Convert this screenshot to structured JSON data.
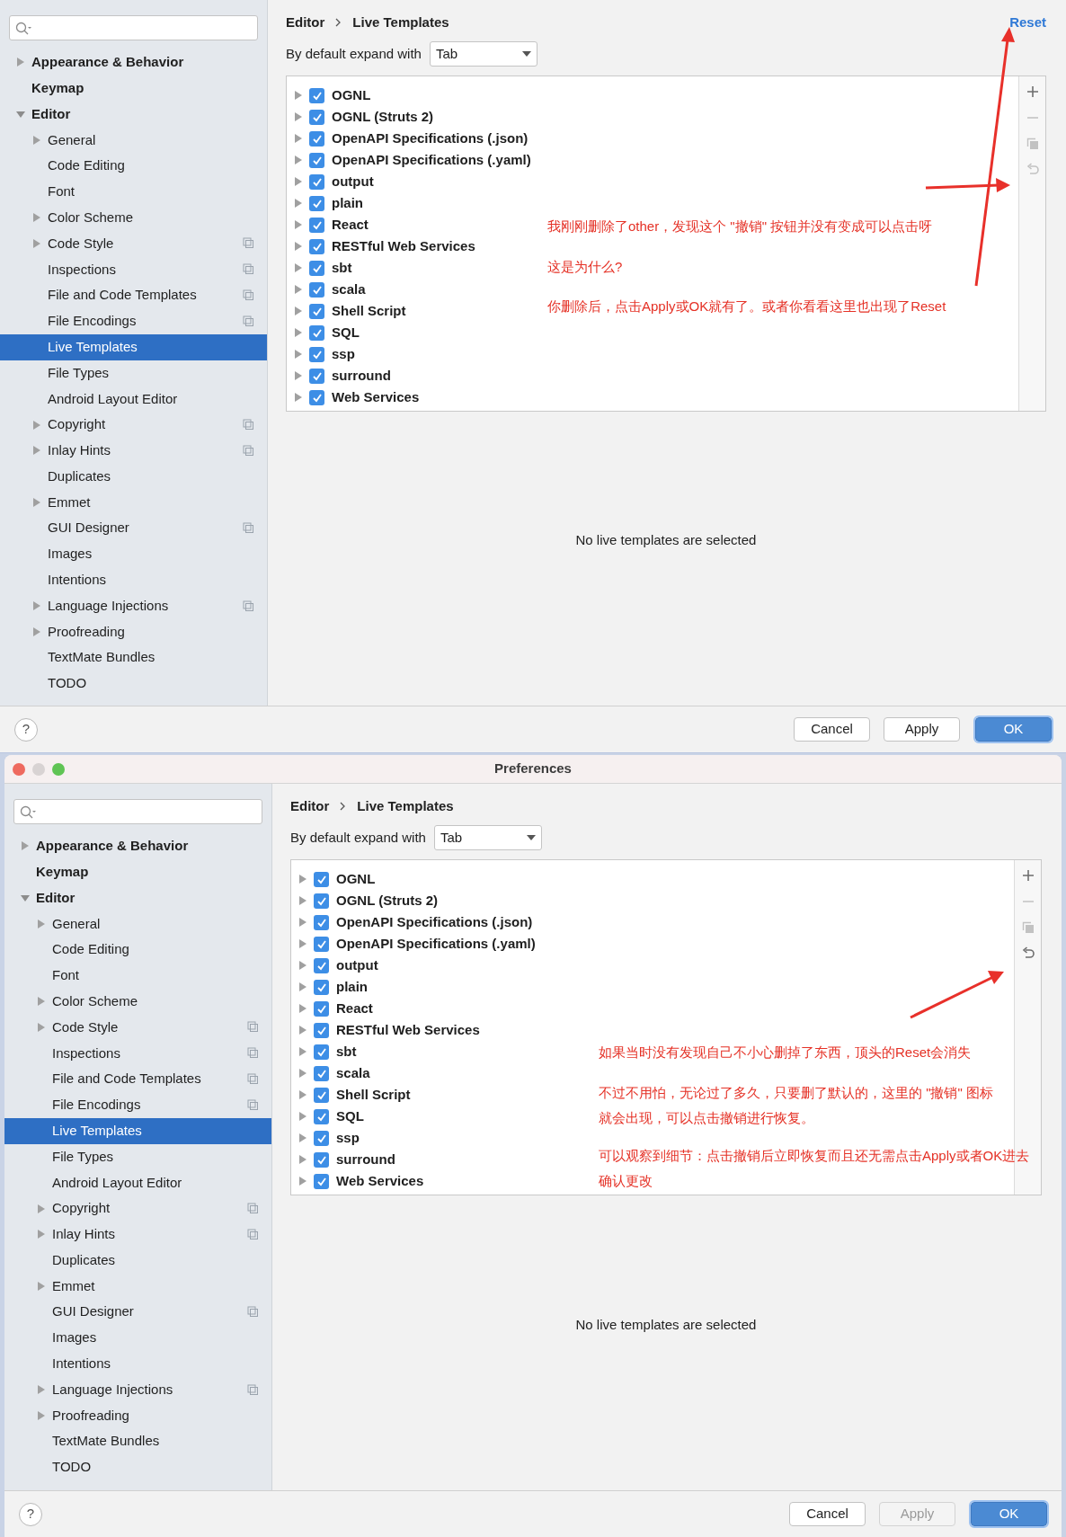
{
  "dialogs": [
    {
      "breadcrumb": [
        "Editor",
        "Live Templates"
      ],
      "reset_link": "Reset",
      "expand_label": "By default expand with",
      "expand_value": "Tab",
      "sidebar": [
        {
          "label": "Appearance & Behavior",
          "bold": true,
          "expanded": false,
          "scoped": false,
          "selected": false
        },
        {
          "label": "Keymap",
          "bold": true,
          "scoped": false,
          "selected": false
        },
        {
          "label": "Editor",
          "bold": true,
          "expanded": true,
          "scoped": false,
          "selected": false,
          "children": [
            {
              "label": "General",
              "expanded": false,
              "scoped": false,
              "selected": false
            },
            {
              "label": "Code Editing",
              "scoped": false,
              "selected": false
            },
            {
              "label": "Font",
              "scoped": false,
              "selected": false
            },
            {
              "label": "Color Scheme",
              "expanded": false,
              "scoped": false,
              "selected": false
            },
            {
              "label": "Code Style",
              "expanded": false,
              "scoped": true,
              "selected": false
            },
            {
              "label": "Inspections",
              "scoped": true,
              "selected": false
            },
            {
              "label": "File and Code Templates",
              "scoped": true,
              "selected": false
            },
            {
              "label": "File Encodings",
              "scoped": true,
              "selected": false
            },
            {
              "label": "Live Templates",
              "scoped": false,
              "selected": true
            },
            {
              "label": "File Types",
              "scoped": false,
              "selected": false
            },
            {
              "label": "Android Layout Editor",
              "scoped": false,
              "selected": false
            },
            {
              "label": "Copyright",
              "expanded": false,
              "scoped": true,
              "selected": false
            },
            {
              "label": "Inlay Hints",
              "expanded": false,
              "scoped": true,
              "selected": false
            },
            {
              "label": "Duplicates",
              "scoped": false,
              "selected": false
            },
            {
              "label": "Emmet",
              "expanded": false,
              "scoped": false,
              "selected": false
            },
            {
              "label": "GUI Designer",
              "scoped": true,
              "selected": false
            },
            {
              "label": "Images",
              "scoped": false,
              "selected": false
            },
            {
              "label": "Intentions",
              "scoped": false,
              "selected": false
            },
            {
              "label": "Language Injections",
              "expanded": false,
              "scoped": true,
              "selected": false
            },
            {
              "label": "Proofreading",
              "expanded": false,
              "scoped": false,
              "selected": false
            },
            {
              "label": "TextMate Bundles",
              "scoped": false,
              "selected": false
            },
            {
              "label": "TODO",
              "scoped": false,
              "selected": false
            }
          ]
        }
      ],
      "templates": [
        {
          "name": "OGNL",
          "checked": true
        },
        {
          "name": "OGNL (Struts 2)",
          "checked": true
        },
        {
          "name": "OpenAPI Specifications (.json)",
          "checked": true
        },
        {
          "name": "OpenAPI Specifications (.yaml)",
          "checked": true
        },
        {
          "name": "output",
          "checked": true
        },
        {
          "name": "plain",
          "checked": true
        },
        {
          "name": "React",
          "checked": true
        },
        {
          "name": "RESTful Web Services",
          "checked": true
        },
        {
          "name": "sbt",
          "checked": true
        },
        {
          "name": "scala",
          "checked": true
        },
        {
          "name": "Shell Script",
          "checked": true
        },
        {
          "name": "SQL",
          "checked": true
        },
        {
          "name": "ssp",
          "checked": true
        },
        {
          "name": "surround",
          "checked": true
        },
        {
          "name": "Web Services",
          "checked": true
        }
      ],
      "toolbar": [
        {
          "kind": "add",
          "disabled": false
        },
        {
          "kind": "remove",
          "disabled": true
        },
        {
          "kind": "copy",
          "disabled": true
        },
        {
          "kind": "restore",
          "disabled": true
        }
      ],
      "annotations": [
        "我刚刚删除了other，发现这个 \"撤销\" 按钮并没有变成可以点击呀",
        "这是为什么?",
        "你删除后，点击Apply或OK就有了。或者你看看这里也出现了Reset"
      ],
      "empty_message": "No live templates are selected",
      "help": "?",
      "buttons": [
        {
          "label": "Cancel",
          "kind": "normal",
          "disabled": false
        },
        {
          "label": "Apply",
          "kind": "normal",
          "disabled": false
        },
        {
          "label": "OK",
          "kind": "default",
          "disabled": false
        }
      ]
    },
    {
      "title": "Preferences",
      "breadcrumb": [
        "Editor",
        "Live Templates"
      ],
      "expand_label": "By default expand with",
      "expand_value": "Tab",
      "sidebar": [
        {
          "label": "Appearance & Behavior",
          "bold": true,
          "expanded": false,
          "scoped": false,
          "selected": false
        },
        {
          "label": "Keymap",
          "bold": true,
          "scoped": false,
          "selected": false
        },
        {
          "label": "Editor",
          "bold": true,
          "expanded": true,
          "scoped": false,
          "selected": false,
          "children": [
            {
              "label": "General",
              "expanded": false,
              "scoped": false,
              "selected": false
            },
            {
              "label": "Code Editing",
              "scoped": false,
              "selected": false
            },
            {
              "label": "Font",
              "scoped": false,
              "selected": false
            },
            {
              "label": "Color Scheme",
              "expanded": false,
              "scoped": false,
              "selected": false
            },
            {
              "label": "Code Style",
              "expanded": false,
              "scoped": true,
              "selected": false
            },
            {
              "label": "Inspections",
              "scoped": true,
              "selected": false
            },
            {
              "label": "File and Code Templates",
              "scoped": true,
              "selected": false
            },
            {
              "label": "File Encodings",
              "scoped": true,
              "selected": false
            },
            {
              "label": "Live Templates",
              "scoped": false,
              "selected": true
            },
            {
              "label": "File Types",
              "scoped": false,
              "selected": false
            },
            {
              "label": "Android Layout Editor",
              "scoped": false,
              "selected": false
            },
            {
              "label": "Copyright",
              "expanded": false,
              "scoped": true,
              "selected": false
            },
            {
              "label": "Inlay Hints",
              "expanded": false,
              "scoped": true,
              "selected": false
            },
            {
              "label": "Duplicates",
              "scoped": false,
              "selected": false
            },
            {
              "label": "Emmet",
              "expanded": false,
              "scoped": false,
              "selected": false
            },
            {
              "label": "GUI Designer",
              "scoped": true,
              "selected": false
            },
            {
              "label": "Images",
              "scoped": false,
              "selected": false
            },
            {
              "label": "Intentions",
              "scoped": false,
              "selected": false
            },
            {
              "label": "Language Injections",
              "expanded": false,
              "scoped": true,
              "selected": false
            },
            {
              "label": "Proofreading",
              "expanded": false,
              "scoped": false,
              "selected": false
            },
            {
              "label": "TextMate Bundles",
              "scoped": false,
              "selected": false
            },
            {
              "label": "TODO",
              "scoped": false,
              "selected": false
            }
          ]
        }
      ],
      "templates": [
        {
          "name": "OGNL",
          "checked": true
        },
        {
          "name": "OGNL (Struts 2)",
          "checked": true
        },
        {
          "name": "OpenAPI Specifications (.json)",
          "checked": true
        },
        {
          "name": "OpenAPI Specifications (.yaml)",
          "checked": true
        },
        {
          "name": "output",
          "checked": true
        },
        {
          "name": "plain",
          "checked": true
        },
        {
          "name": "React",
          "checked": true
        },
        {
          "name": "RESTful Web Services",
          "checked": true
        },
        {
          "name": "sbt",
          "checked": true
        },
        {
          "name": "scala",
          "checked": true
        },
        {
          "name": "Shell Script",
          "checked": true
        },
        {
          "name": "SQL",
          "checked": true
        },
        {
          "name": "ssp",
          "checked": true
        },
        {
          "name": "surround",
          "checked": true
        },
        {
          "name": "Web Services",
          "checked": true
        }
      ],
      "toolbar": [
        {
          "kind": "add",
          "disabled": false
        },
        {
          "kind": "remove",
          "disabled": true
        },
        {
          "kind": "copy",
          "disabled": true
        },
        {
          "kind": "restore",
          "disabled": false
        }
      ],
      "annotations": [
        "如果当时没有发现自己不小心删掉了东西，顶头的Reset会消失",
        "不过不用怕，无论过了多久，只要删了默认的，这里的 \"撤销\" 图标就会出现，可以点击撤销进行恢复。",
        "可以观察到细节：点击撤销后立即恢复而且还无需点击Apply或者OK进去确认更改"
      ],
      "empty_message": "No live templates are selected",
      "help": "?",
      "buttons": [
        {
          "label": "Cancel",
          "kind": "normal",
          "disabled": false
        },
        {
          "label": "Apply",
          "kind": "normal",
          "disabled": true
        },
        {
          "label": "OK",
          "kind": "default",
          "disabled": false
        }
      ]
    }
  ]
}
